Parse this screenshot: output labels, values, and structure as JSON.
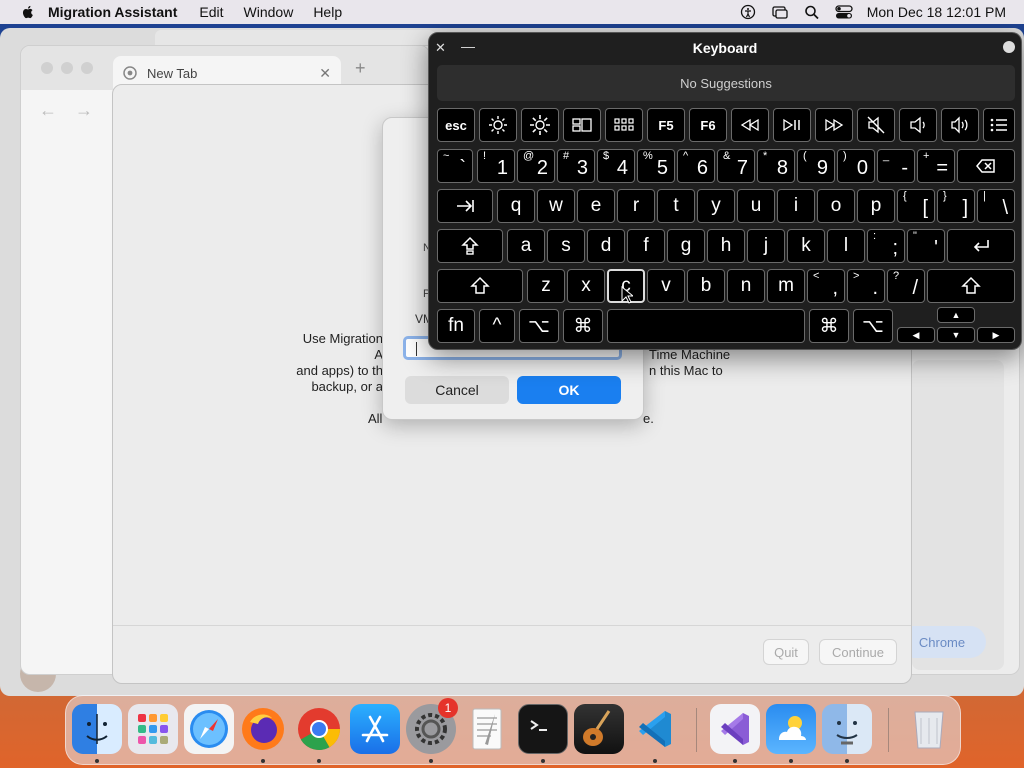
{
  "menubar": {
    "app_name": "Migration Assistant",
    "menus": [
      "Edit",
      "Window",
      "Help"
    ],
    "datetime": "Mon Dec 18  12:01 PM"
  },
  "chrome": {
    "tab_title": "New Tab",
    "right_button": "Chrome"
  },
  "migration": {
    "desc_left": "Use Migration Assistant to transfer information (including documents and apps) to this Mac from another Mac, Time Machine backup, or a PC.",
    "desc_line1_left": "Use Migration A",
    "desc_line2_left": "and apps) to th",
    "desc_line3_left": "backup, or a",
    "desc_line1_right": "Time Machine",
    "desc_line2_right": "n this Mac to",
    "notice": "All other apps will quit when you click Continue.",
    "notice_left": "All ",
    "notice_right": "e.",
    "quit_label": "Quit",
    "continue_label": "Continue"
  },
  "sheet": {
    "label1": "N",
    "label2": "P",
    "field_label": "VM",
    "field_value": "",
    "cancel_label": "Cancel",
    "ok_label": "OK"
  },
  "keyboard": {
    "title": "Keyboard",
    "suggestions": "No Suggestions",
    "keys": {
      "esc": "esc",
      "f5": "F5",
      "f6": "F6",
      "tilde_sh": "~",
      "tilde": "`",
      "n1_sh": "!",
      "n1": "1",
      "n2_sh": "@",
      "n2": "2",
      "n3_sh": "#",
      "n3": "3",
      "n4_sh": "$",
      "n4": "4",
      "n5_sh": "%",
      "n5": "5",
      "n6_sh": "^",
      "n6": "6",
      "n7_sh": "&",
      "n7": "7",
      "n8_sh": "*",
      "n8": "8",
      "n9_sh": "(",
      "n9": "9",
      "n0_sh": ")",
      "n0": "0",
      "minus_sh": "_",
      "minus": "-",
      "eq_sh": "+",
      "eq": "=",
      "q": "q",
      "w": "w",
      "e": "e",
      "r": "r",
      "t": "t",
      "y": "y",
      "u": "u",
      "i": "i",
      "o": "o",
      "p": "p",
      "lb_sh": "{",
      "lb": "[",
      "rb_sh": "}",
      "rb": "]",
      "bs_sh": "|",
      "bs": "\\",
      "a": "a",
      "s": "s",
      "d": "d",
      "f": "f",
      "g": "g",
      "h": "h",
      "j": "j",
      "k": "k",
      "l": "l",
      "semi_sh": ":",
      "semi": ";",
      "quote_sh": "\"",
      "quote": "'",
      "z": "z",
      "x": "x",
      "c": "c",
      "v": "v",
      "b": "b",
      "n": "n",
      "m": "m",
      "comma_sh": "<",
      "comma": ",",
      "period_sh": ">",
      "period": ".",
      "slash_sh": "?",
      "slash": "/",
      "fn": "fn",
      "ctrl": "^",
      "opt": "⌥",
      "cmd": "⌘"
    }
  },
  "dock": {
    "settings_badge": "1"
  }
}
